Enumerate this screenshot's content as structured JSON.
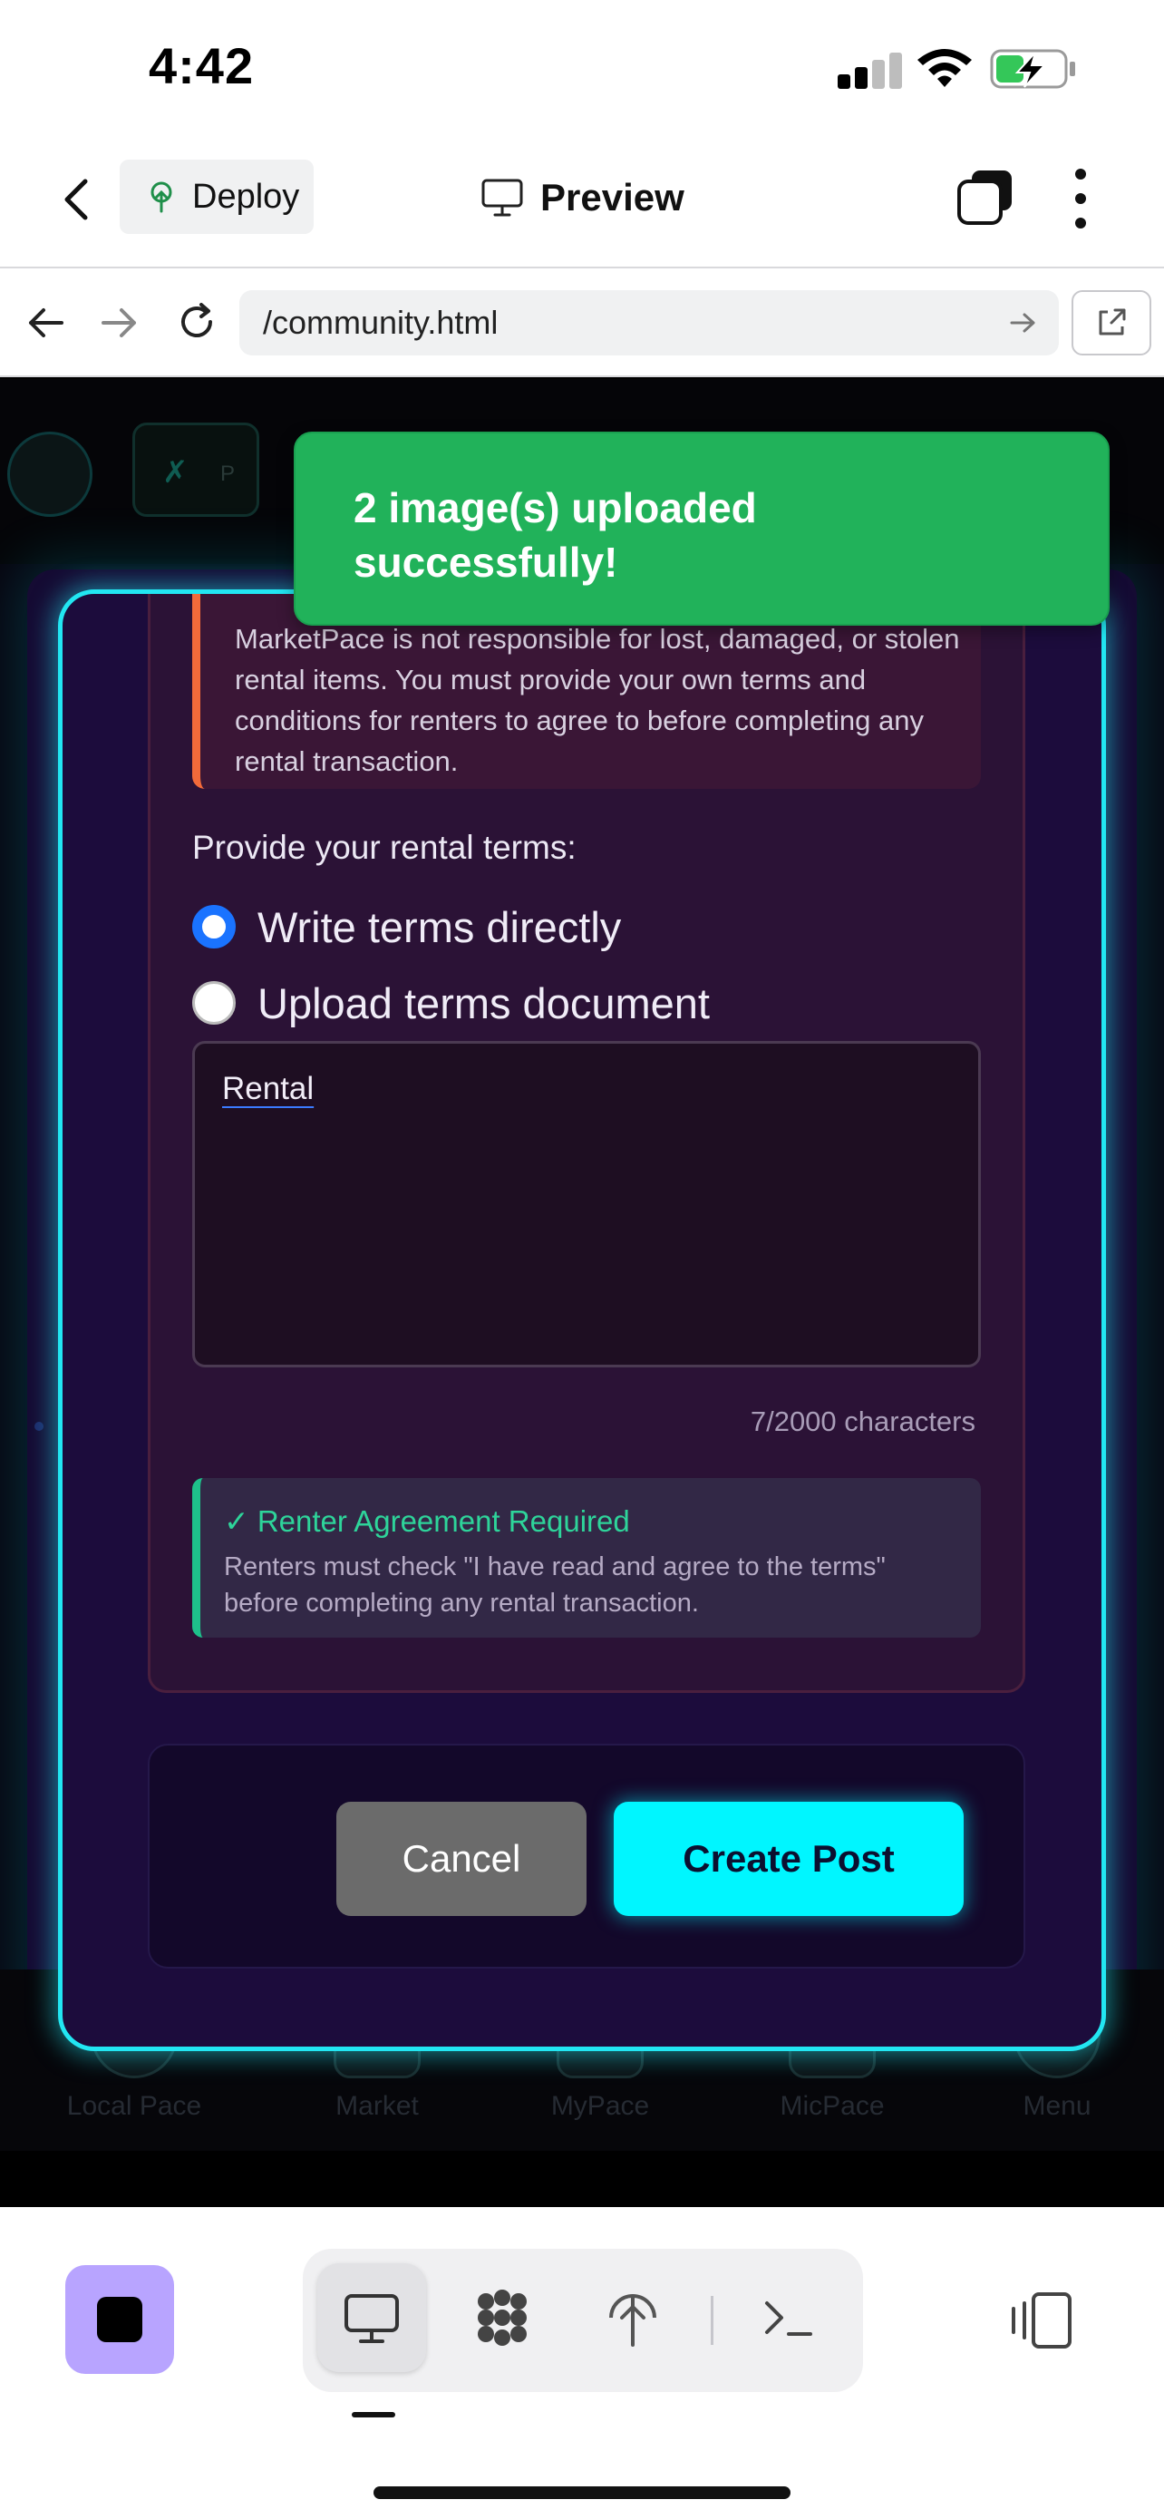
{
  "status_bar": {
    "time": "4:42"
  },
  "top_bar": {
    "deploy_label": "Deploy",
    "preview_label": "Preview"
  },
  "address_bar": {
    "url": "/community.html"
  },
  "background_page": {
    "header_chip_letter": "P",
    "bottom_nav": [
      {
        "label": "Local Pace"
      },
      {
        "label": "Market"
      },
      {
        "label": "MyPace"
      },
      {
        "label": "MicPace"
      },
      {
        "label": "Menu"
      }
    ]
  },
  "toast": {
    "message": "2 image(s) uploaded successfully!"
  },
  "modal": {
    "warning_text": "MarketPace is not responsible for lost, damaged, or stolen rental items. You must provide your own terms and conditions for renters to agree to before completing any rental transaction.",
    "terms_heading": "Provide your rental terms:",
    "options": [
      {
        "label": "Write terms directly",
        "selected": true
      },
      {
        "label": "Upload terms document",
        "selected": false
      }
    ],
    "terms_value": "Rental",
    "char_count": "7/2000 characters",
    "agreement_title": "✓ Renter Agreement Required",
    "agreement_text": "Renters must check \"I have read and agree to the terms\" before completing any rental transaction.",
    "cancel_label": "Cancel",
    "create_label": "Create Post"
  },
  "colors": {
    "modal_border": "#22e6f2",
    "create_button": "#00f6ff",
    "toast_bg": "#21b25a",
    "warning_accent": "#f26a3a",
    "agreement_accent": "#1ec08a",
    "radio_selected": "#1a73ff"
  },
  "toolbar": {
    "icons": [
      "desktop-icon",
      "grid-icon",
      "deploy-icon",
      "terminal-icon"
    ]
  }
}
